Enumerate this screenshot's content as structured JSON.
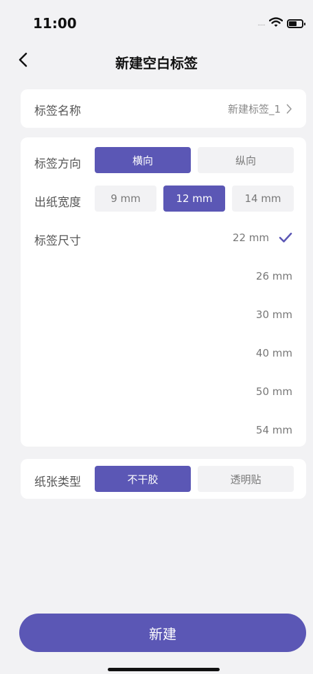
{
  "status": {
    "time": "11:00",
    "signal": "....."
  },
  "nav": {
    "title": "新建空白标签"
  },
  "label_name": {
    "label": "标签名称",
    "value": "新建标签_1"
  },
  "direction": {
    "label": "标签方向",
    "options": [
      "横向",
      "纵向"
    ],
    "selected": "横向"
  },
  "width": {
    "label": "出纸宽度",
    "options": [
      "9 mm",
      "12 mm",
      "14 mm"
    ],
    "selected": "12 mm"
  },
  "size": {
    "label": "标签尺寸",
    "options": [
      "22 mm",
      "26 mm",
      "30 mm",
      "40 mm",
      "50 mm",
      "54 mm"
    ],
    "selected": "22 mm"
  },
  "paper": {
    "label": "纸张类型",
    "options": [
      "不干胶",
      "透明贴"
    ],
    "selected": "不干胶"
  },
  "create_button": "新建",
  "colors": {
    "accent": "#5b57b5",
    "background": "#f2f2f4",
    "card": "#ffffff"
  }
}
